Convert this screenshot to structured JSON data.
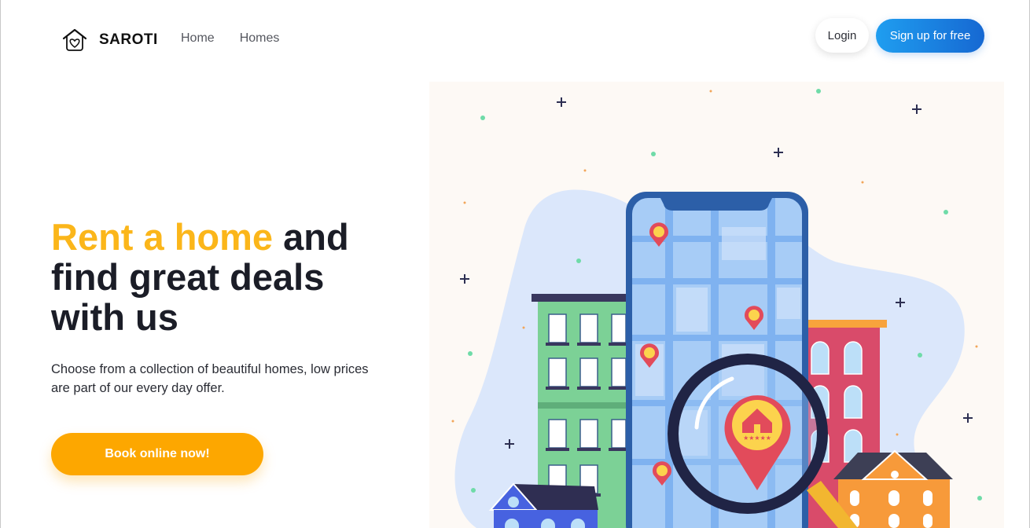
{
  "brand": {
    "name": "SAROTI",
    "logo_icon": "house-heart-icon"
  },
  "nav": {
    "items": [
      {
        "label": "Home"
      },
      {
        "label": "Homes"
      }
    ]
  },
  "auth": {
    "login_label": "Login",
    "signup_label": "Sign up for free"
  },
  "hero": {
    "title_accent": "Rent a home",
    "title_rest_line1": " and",
    "title_line2": "find great deals",
    "title_line3": "with us",
    "subtitle": "Choose from a collection of beautiful homes, low prices are part of our every day offer.",
    "cta_label": "Book online now!"
  },
  "illustration": {
    "name": "city-map-search-illustration",
    "rating_stars": "★★★★★"
  },
  "colors": {
    "accent_yellow": "#fbb61a",
    "cta_orange": "#fda700",
    "signup_blue_start": "#1f9ef0",
    "signup_blue_end": "#1668d2",
    "text_dark": "#1b1d27"
  }
}
